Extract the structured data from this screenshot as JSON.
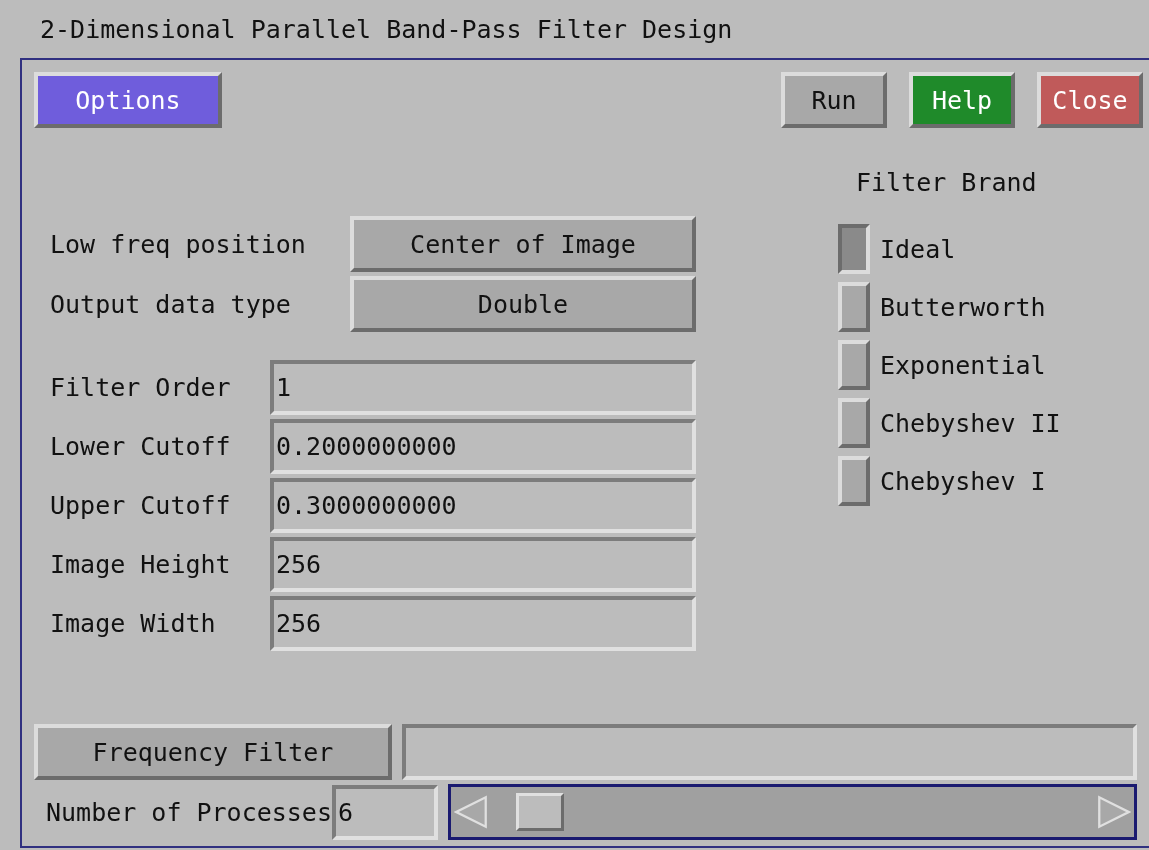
{
  "window": {
    "title": "2-Dimensional Parallel Band-Pass Filter Design"
  },
  "toolbar": {
    "menu": "Options",
    "buttons": [
      {
        "label": "Run",
        "kind": "run"
      },
      {
        "label": "Help",
        "kind": "help"
      },
      {
        "label": "Close",
        "kind": "close"
      }
    ]
  },
  "options": [
    {
      "label": "Low freq position",
      "value": "Center of Image"
    },
    {
      "label": "Output data type",
      "value": "Double"
    }
  ],
  "fields": [
    {
      "label": "Filter Order",
      "value": "1"
    },
    {
      "label": "Lower Cutoff",
      "value": "0.2000000000"
    },
    {
      "label": "Upper Cutoff",
      "value": "0.3000000000"
    },
    {
      "label": "Image Height",
      "value": "256"
    },
    {
      "label": "Image Width",
      "value": "256"
    }
  ],
  "filter_brand": {
    "title": "Filter Brand",
    "items": [
      {
        "label": "Ideal",
        "selected": true
      },
      {
        "label": "Butterworth",
        "selected": false
      },
      {
        "label": "Exponential",
        "selected": false
      },
      {
        "label": "Chebyshev II",
        "selected": false
      },
      {
        "label": "Chebyshev I",
        "selected": false
      }
    ]
  },
  "bottom": {
    "action": "Frequency Filter",
    "processes": {
      "label": "Number of Processes",
      "value": "6"
    }
  }
}
